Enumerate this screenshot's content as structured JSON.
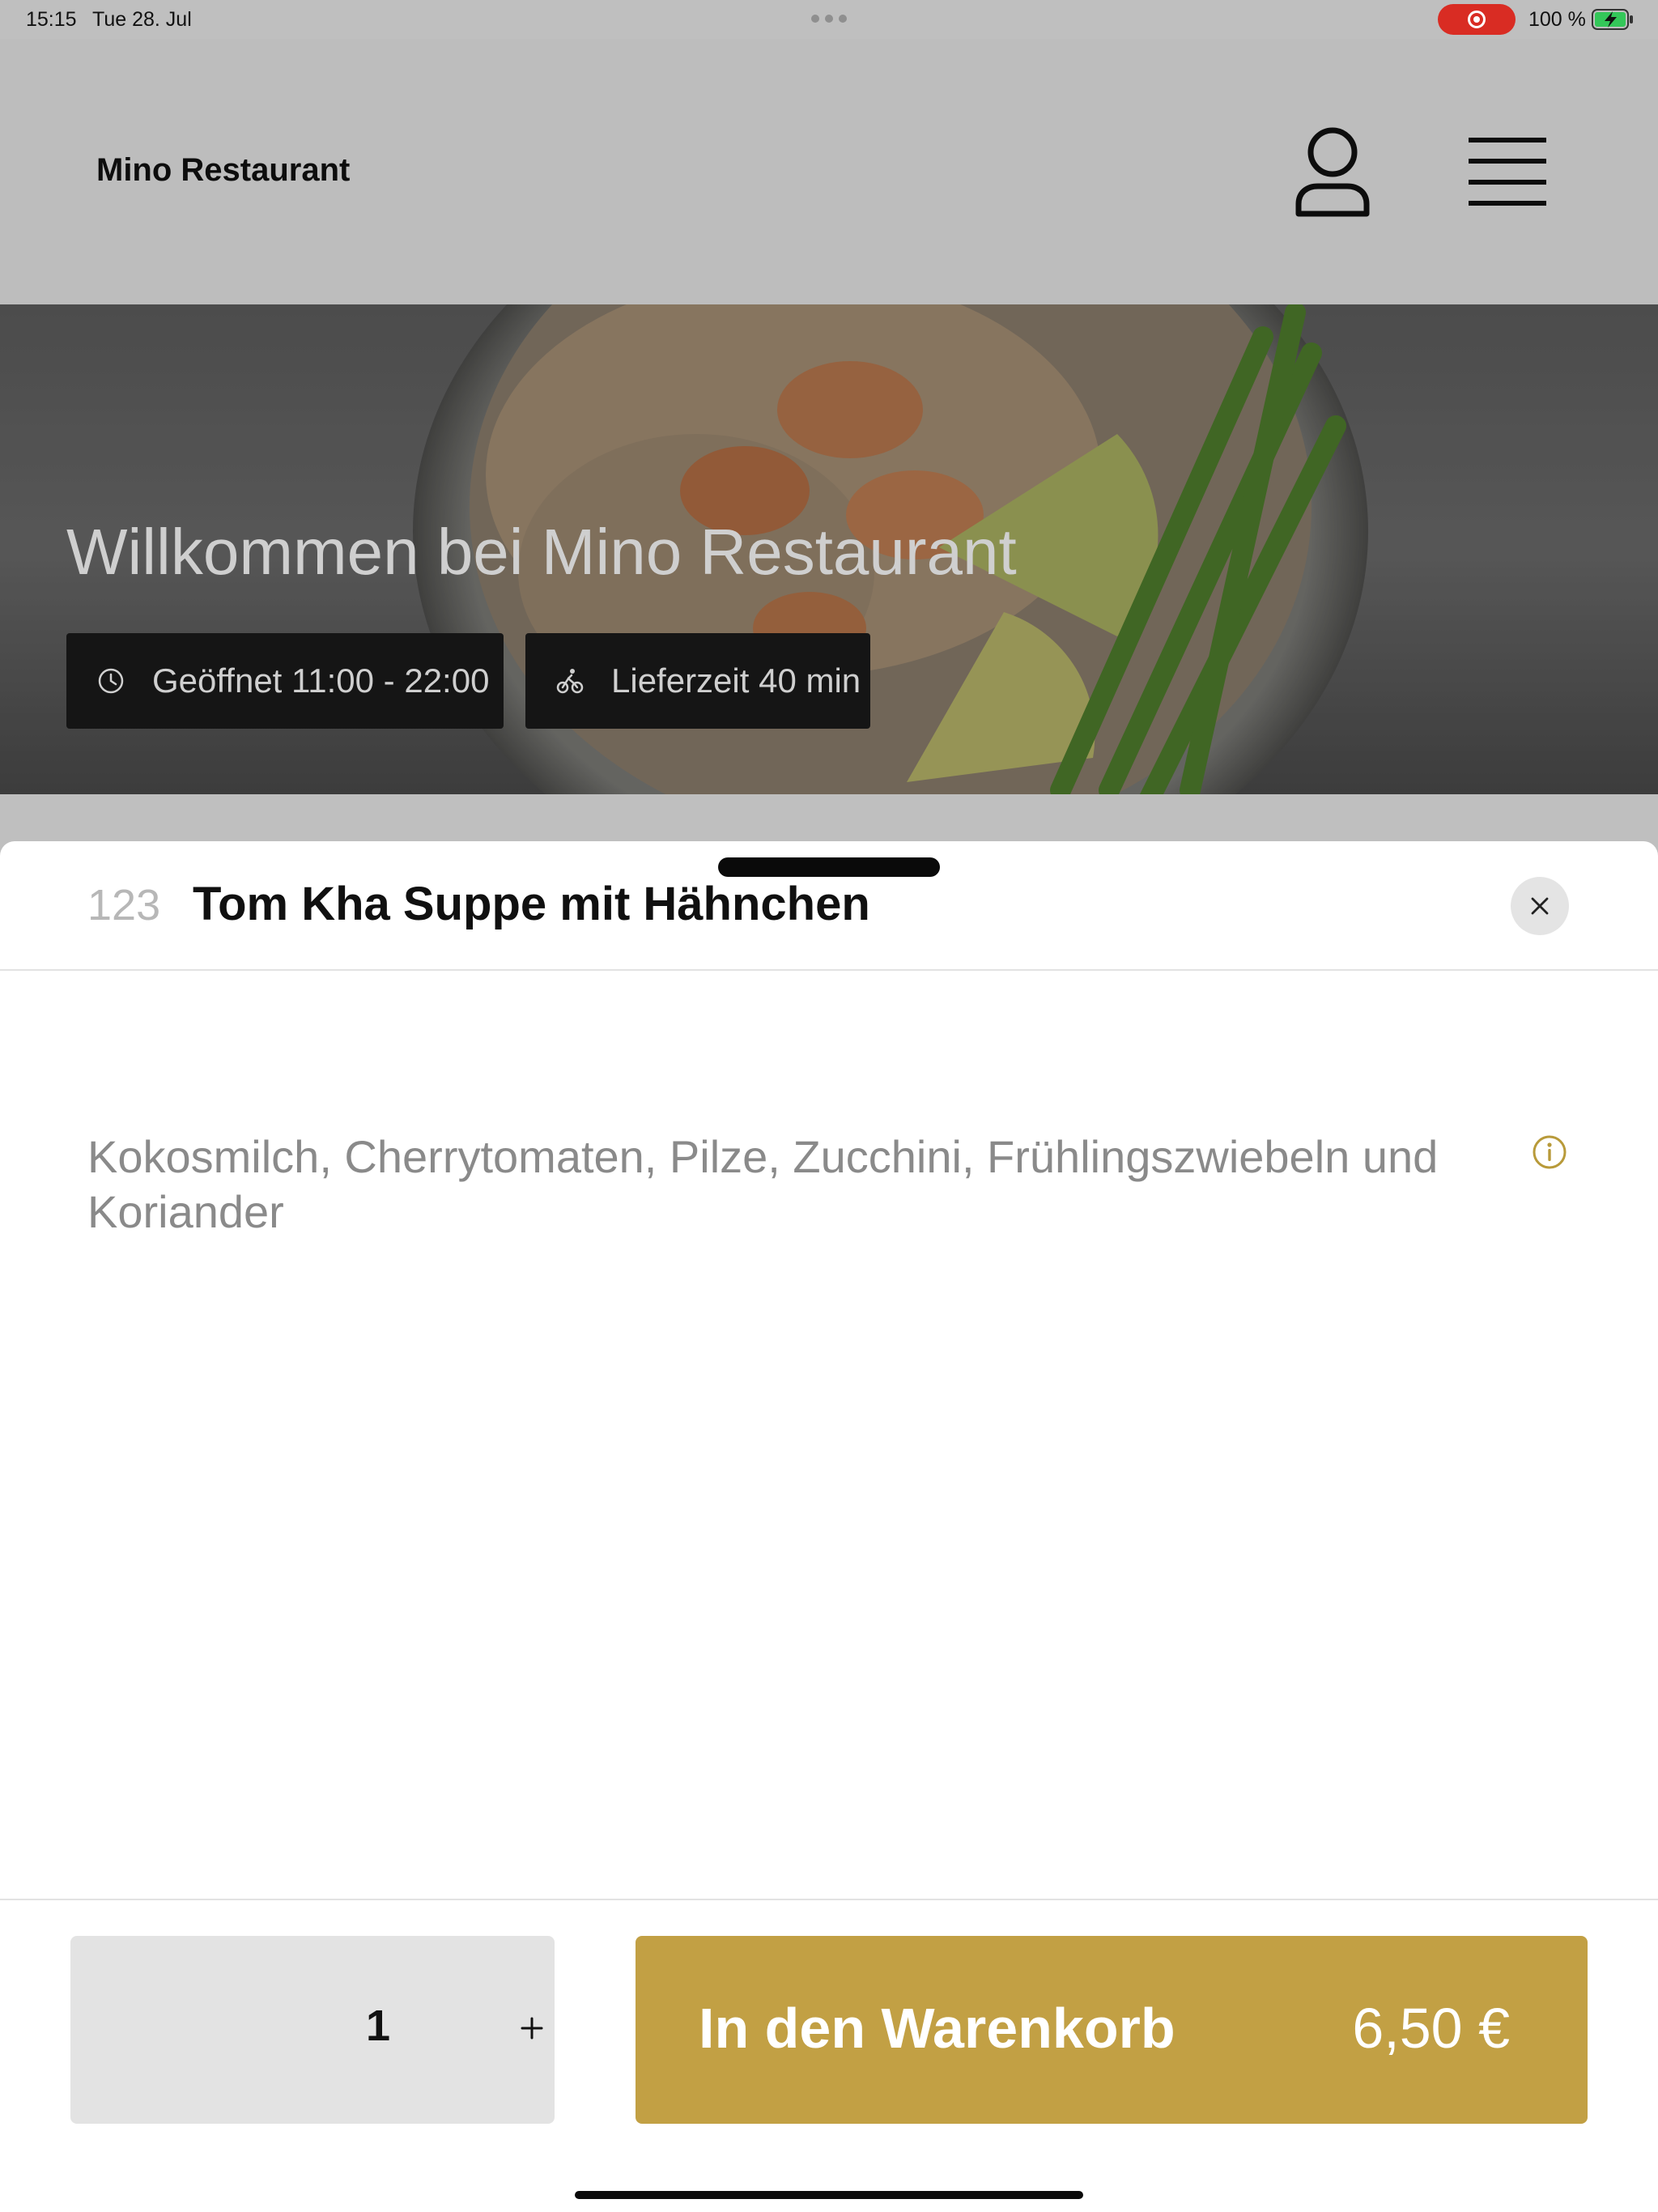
{
  "status_bar": {
    "time": "15:15",
    "date": "Tue 28. Jul",
    "battery": "100 %",
    "icons": [
      "screen-recording-icon",
      "battery-charging-icon"
    ]
  },
  "header": {
    "brand": "Mino Restaurant",
    "icons": [
      "user-icon",
      "hamburger-menu-icon"
    ]
  },
  "hero": {
    "title": "Willkommen bei Mino Restaurant",
    "opening_hours": "Geöffnet 11:00 - 22:00",
    "delivery_time": "Lieferzeit 40 min",
    "icons": [
      "clock-icon",
      "bicycle-delivery-icon"
    ]
  },
  "item": {
    "number": "123",
    "title": "Tom Kha Suppe mit Hähnchen",
    "description": "Kokosmilch, Cherrytomaten, Pilze, Zucchini, Frühlingszwiebeln und Koriander",
    "icons": [
      "close-icon",
      "info-icon"
    ]
  },
  "footer": {
    "quantity": "1",
    "plus_label": "+",
    "cart_label": "In den Warenkorb",
    "price": "6,50 €"
  },
  "colors": {
    "accent": "#c2a044",
    "info_icon": "#b89a3a",
    "recording": "#d92c23",
    "overlay_background": "#bfbfbf"
  }
}
